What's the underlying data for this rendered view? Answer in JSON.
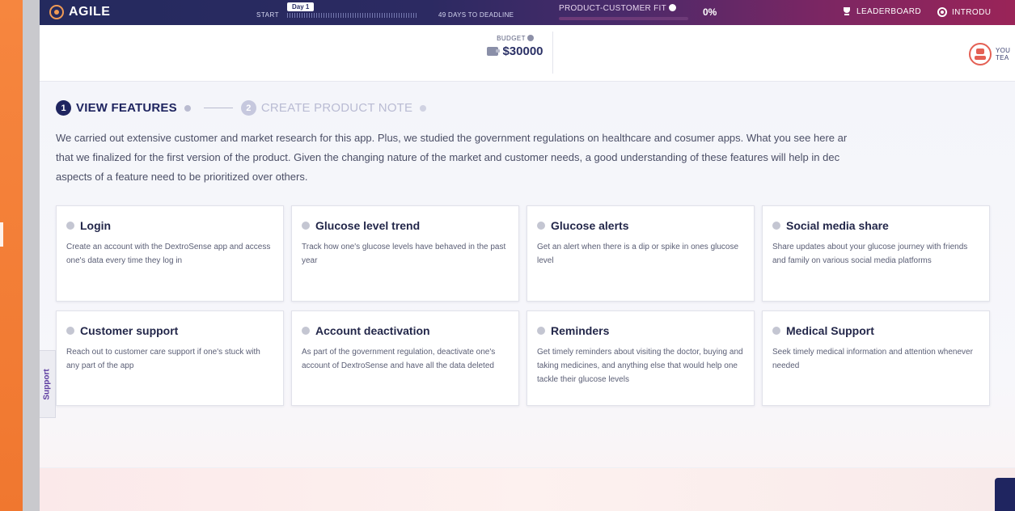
{
  "topbar": {
    "brand": "AGILE",
    "timeline_start": "START",
    "day_badge": "Day 1",
    "deadline": "49 DAYS TO DEADLINE",
    "pcf_label": "PRODUCT-CUSTOMER FIT",
    "pcf_value": "0%",
    "pcf_progress": 0,
    "leaderboard": "LEADERBOARD",
    "introduction": "INTRODU"
  },
  "header": {
    "budget_label": "BUDGET",
    "budget_value": "$30000",
    "team_label_line1": "YOU",
    "team_label_line2": "TEA"
  },
  "steps": [
    {
      "num": "1",
      "label": "VIEW FEATURES",
      "active": true
    },
    {
      "num": "2",
      "label": "CREATE PRODUCT NOTE",
      "active": false
    }
  ],
  "intro": {
    "line1": "We carried out extensive customer and market research for this app. Plus, we studied the government regulations on healthcare and cosumer apps. What you see here ar",
    "line2": "that we finalized for the first version of the product. Given the changing nature of the market and customer needs, a good understanding of these features will help in dec",
    "line3": "aspects of a feature need to be prioritized over others."
  },
  "features": [
    {
      "title": "Login",
      "desc": "Create an account with the DextroSense app and access one's data every time they log in"
    },
    {
      "title": "Glucose level trend",
      "desc": "Track how one's glucose levels have behaved in the past year"
    },
    {
      "title": "Glucose alerts",
      "desc": "Get an alert when there is a dip or spike in ones glucose level"
    },
    {
      "title": "Social media share",
      "desc": "Share updates about your glucose journey with friends and family on various social media platforms"
    },
    {
      "title": "Customer support",
      "desc": "Reach out to customer care support if one's stuck with any part of the app"
    },
    {
      "title": "Account deactivation",
      "desc": "As part of the government regulation, deactivate one's account of DextroSense and have all the data deleted"
    },
    {
      "title": "Reminders",
      "desc": "Get timely reminders about visiting the doctor, buying and taking medicines, and anything else that would help one tackle their glucose levels"
    },
    {
      "title": "Medical Support",
      "desc": "Seek timely medical information and attention whenever needed"
    }
  ],
  "support_tab": "Support",
  "colors": {
    "navy": "#1f2560",
    "accent_orange": "#f37b34",
    "topbar_end": "#9a2458"
  }
}
